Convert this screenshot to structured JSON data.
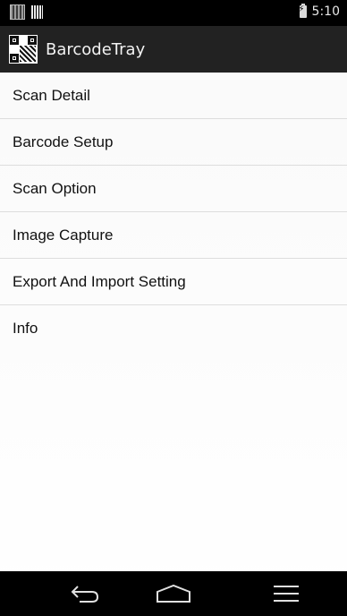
{
  "status_bar": {
    "time": "5:10",
    "left_icons": [
      "qr-notification-icon",
      "barcode-notification-icon"
    ],
    "battery_icon": "battery-charging-icon"
  },
  "action_bar": {
    "title": "BarcodeTray",
    "icon": "qr-code-app-icon"
  },
  "menu": {
    "items": [
      {
        "label": "Scan Detail"
      },
      {
        "label": "Barcode Setup"
      },
      {
        "label": "Scan Option"
      },
      {
        "label": "Image Capture"
      },
      {
        "label": "Export And Import Setting"
      },
      {
        "label": "Info"
      }
    ]
  },
  "nav_bar": {
    "back_icon": "back-icon",
    "home_icon": "home-icon",
    "menu_icon": "menu-icon"
  },
  "colors": {
    "status_bar_bg": "#000000",
    "action_bar_bg": "#222222",
    "list_bg": "#ffffff",
    "divider": "#dddddd",
    "text": "#111111"
  }
}
